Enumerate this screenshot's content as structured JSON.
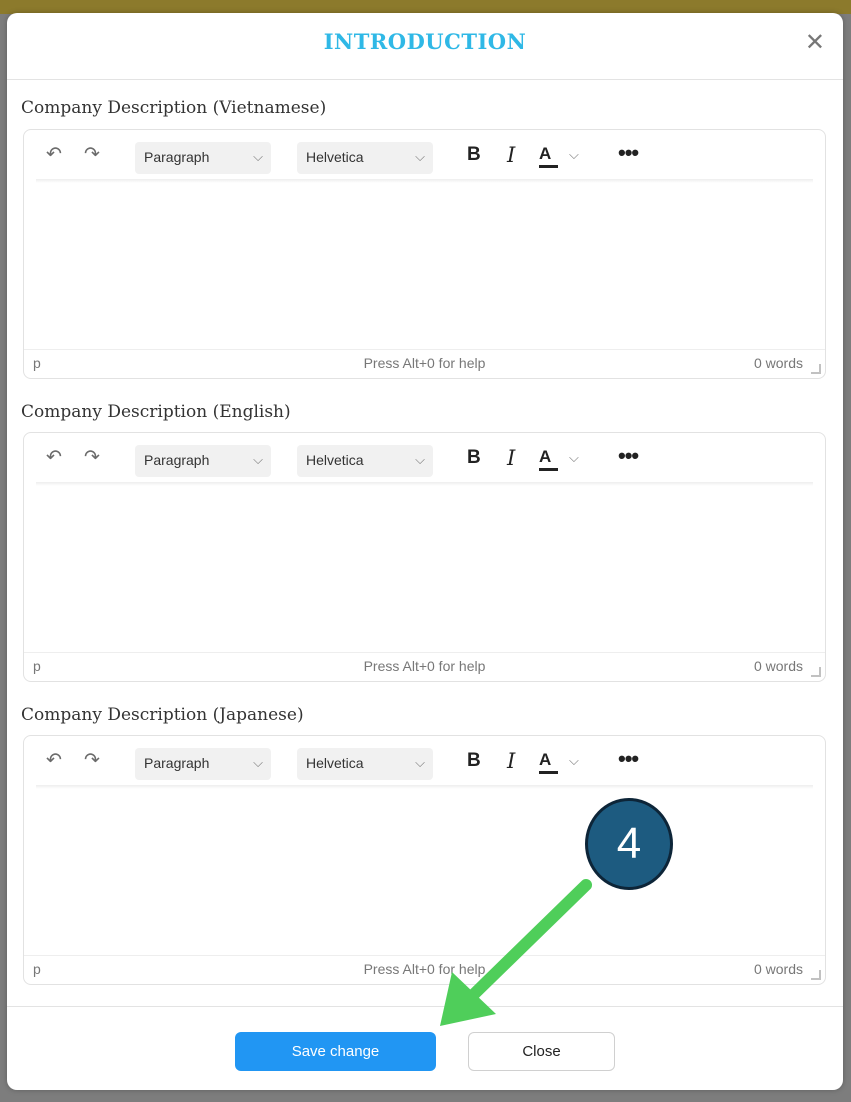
{
  "modal": {
    "title": "INTRODUCTION",
    "close_icon": "close-icon"
  },
  "editors": [
    {
      "label": "Company Description (Vietnamese)",
      "block_format": "Paragraph",
      "font_family": "Helvetica",
      "path": "p",
      "help": "Press Alt+0 for help",
      "word_count": "0 words"
    },
    {
      "label": "Company Description (English)",
      "block_format": "Paragraph",
      "font_family": "Helvetica",
      "path": "p",
      "help": "Press Alt+0 for help",
      "word_count": "0 words"
    },
    {
      "label": "Company Description (Japanese)",
      "block_format": "Paragraph",
      "font_family": "Helvetica",
      "path": "p",
      "help": "Press Alt+0 for help",
      "word_count": "0 words"
    }
  ],
  "toolbar": {
    "bold": "B",
    "italic": "I",
    "font_color": "A",
    "more": "•••"
  },
  "footer": {
    "save_label": "Save change",
    "close_label": "Close"
  },
  "annotation": {
    "step": "4"
  },
  "colors": {
    "title": "#2fb8e6",
    "save_button": "#2196f3",
    "arrow": "#4fce5a",
    "step_badge": "#1d5b80"
  }
}
